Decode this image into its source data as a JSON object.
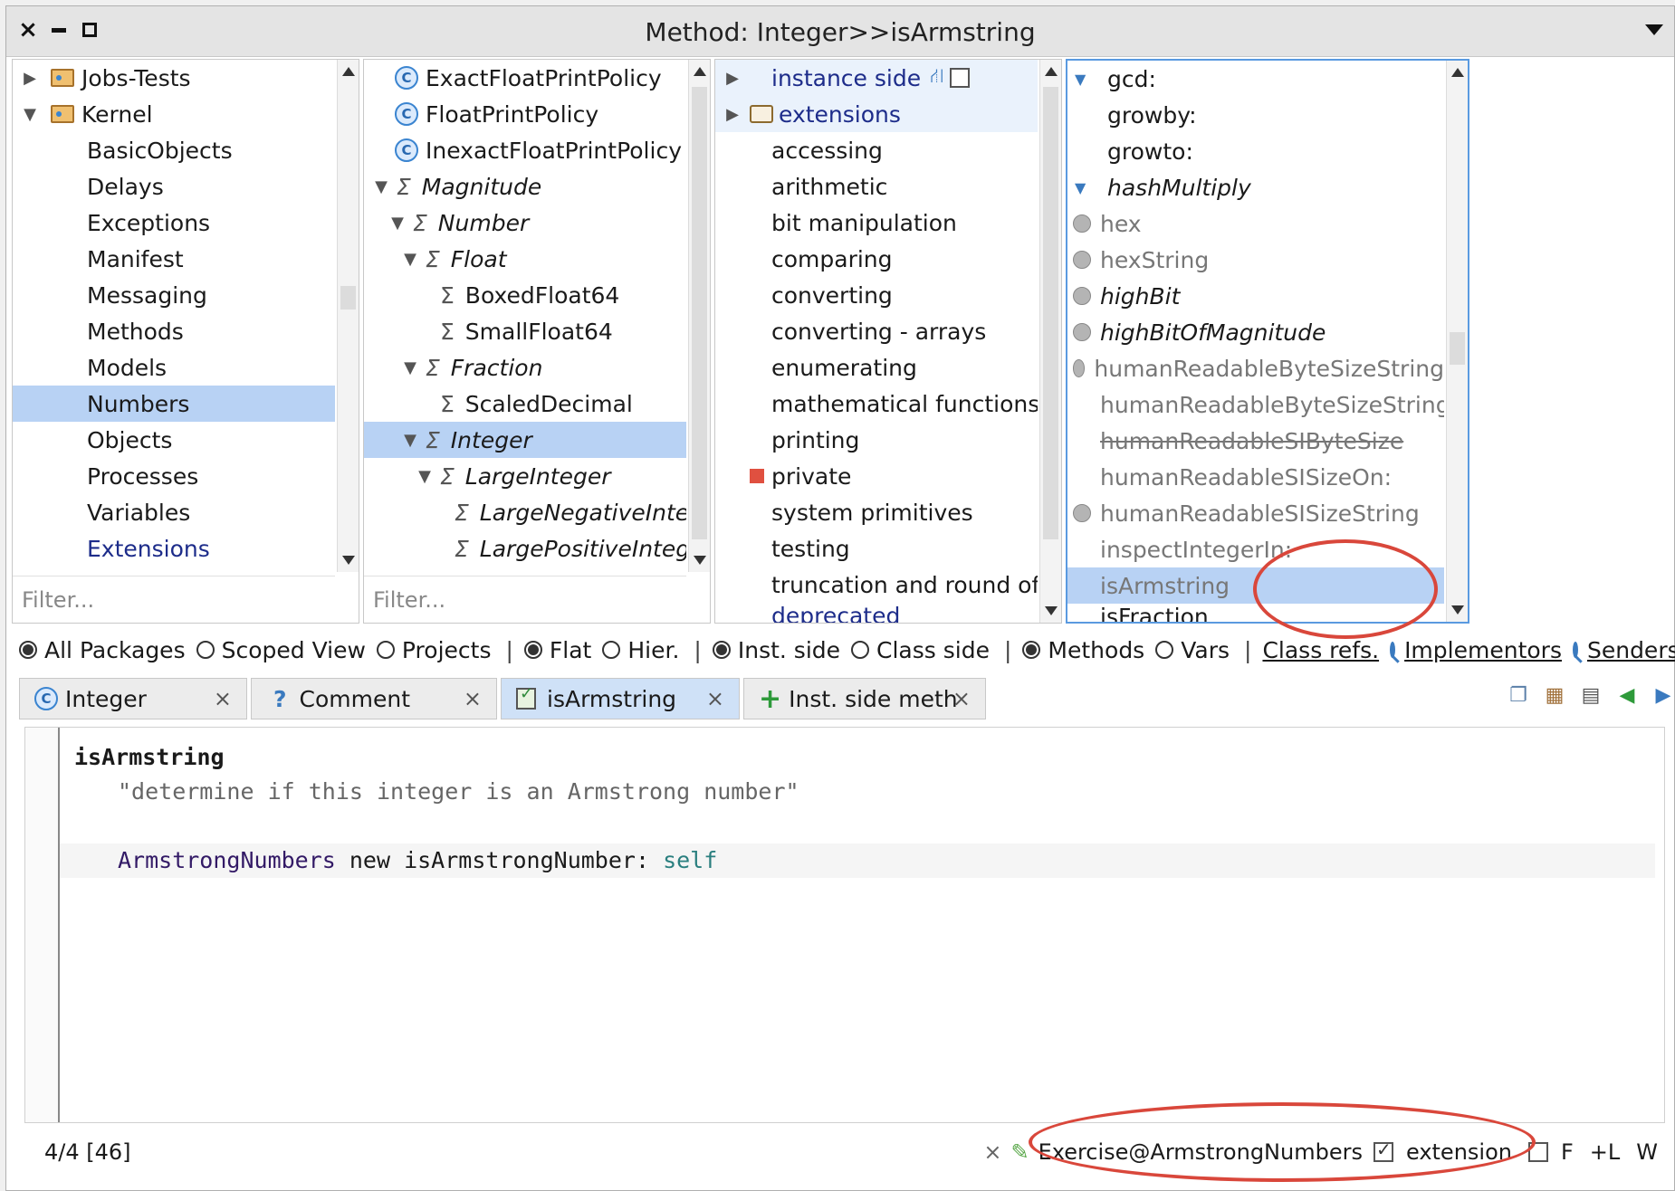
{
  "window": {
    "title": "Method: Integer>>isArmstring"
  },
  "packages": {
    "items": [
      {
        "label": "Jobs-Tests",
        "type": "package",
        "expanded": false
      },
      {
        "label": "Kernel",
        "type": "package",
        "expanded": true
      },
      {
        "label": "BasicObjects"
      },
      {
        "label": "Delays"
      },
      {
        "label": "Exceptions"
      },
      {
        "label": "Manifest"
      },
      {
        "label": "Messaging"
      },
      {
        "label": "Methods"
      },
      {
        "label": "Models"
      },
      {
        "label": "Numbers",
        "selected": true
      },
      {
        "label": "Objects"
      },
      {
        "label": "Processes"
      },
      {
        "label": "Variables"
      },
      {
        "label": "Extensions",
        "color": "blue"
      }
    ],
    "filter_placeholder": "Filter..."
  },
  "classes": {
    "items": [
      {
        "label": "ExactFloatPrintPolicy",
        "icon": "class-icon"
      },
      {
        "label": "FloatPrintPolicy",
        "icon": "class-icon"
      },
      {
        "label": "InexactFloatPrintPolicy",
        "icon": "class-icon"
      },
      {
        "label": "Magnitude",
        "icon": "sigma-icon",
        "italic": true,
        "depth": 0,
        "expanded": true
      },
      {
        "label": "Number",
        "icon": "sigma-icon",
        "italic": true,
        "depth": 1,
        "expanded": true
      },
      {
        "label": "Float",
        "icon": "sigma-icon",
        "italic": true,
        "depth": 2,
        "expanded": true
      },
      {
        "label": "BoxedFloat64",
        "icon": "sigma-icon",
        "depth": 3
      },
      {
        "label": "SmallFloat64",
        "icon": "sigma-icon",
        "depth": 3
      },
      {
        "label": "Fraction",
        "icon": "sigma-icon",
        "italic": true,
        "depth": 2,
        "expanded": true
      },
      {
        "label": "ScaledDecimal",
        "icon": "sigma-icon",
        "depth": 3
      },
      {
        "label": "Integer",
        "icon": "sigma-icon",
        "italic": true,
        "depth": 2,
        "expanded": true,
        "selected": true
      },
      {
        "label": "LargeInteger",
        "icon": "sigma-icon",
        "italic": true,
        "depth": 3,
        "expanded": true
      },
      {
        "label": "LargeNegativeInteger",
        "icon": "sigma-icon",
        "italic": true,
        "depth": 4
      },
      {
        "label": "LargePositiveInteger",
        "icon": "sigma-icon",
        "italic": true,
        "depth": 4
      }
    ],
    "filter_placeholder": "Filter..."
  },
  "protocols": {
    "items": [
      {
        "label": "instance side",
        "color": "blue",
        "expandable": true
      },
      {
        "label": "extensions",
        "color": "blue",
        "expandable": true,
        "folder": true
      },
      {
        "label": "accessing"
      },
      {
        "label": "arithmetic"
      },
      {
        "label": "bit manipulation"
      },
      {
        "label": "comparing"
      },
      {
        "label": "converting"
      },
      {
        "label": "converting - arrays"
      },
      {
        "label": "enumerating"
      },
      {
        "label": "mathematical functions"
      },
      {
        "label": "printing"
      },
      {
        "label": "private",
        "marker": "red-square"
      },
      {
        "label": "system primitives"
      },
      {
        "label": "testing"
      },
      {
        "label": "truncation and round off"
      },
      {
        "label": "deprecated",
        "color": "blue",
        "underline": true
      }
    ]
  },
  "methods": {
    "items": [
      {
        "label": "gcd:",
        "marker": "expand-arrow"
      },
      {
        "label": "growby:"
      },
      {
        "label": "growto:"
      },
      {
        "label": "hashMultiply",
        "italic": true,
        "marker": "expand-arrow"
      },
      {
        "label": "hex",
        "marker": "grey-dot",
        "grey": true
      },
      {
        "label": "hexString",
        "marker": "grey-dot",
        "grey": true
      },
      {
        "label": "highBit",
        "marker": "grey-dot",
        "italic": true
      },
      {
        "label": "highBitOfMagnitude",
        "marker": "grey-dot",
        "italic": true
      },
      {
        "label": "humanReadableByteSizeString",
        "marker": "grey-dot",
        "grey": true
      },
      {
        "label": "humanReadableByteSizeStringPreci",
        "grey": true
      },
      {
        "label": "humanReadableSIByteSize",
        "grey": true,
        "strike": true
      },
      {
        "label": "humanReadableSISizeOn:",
        "grey": true
      },
      {
        "label": "humanReadableSISizeString",
        "marker": "grey-dot",
        "grey": true
      },
      {
        "label": "inspectIntegerIn:",
        "grey": true
      },
      {
        "label": "isArmstring",
        "selected": true,
        "grey": true
      },
      {
        "label": "isFraction"
      }
    ]
  },
  "toolbar": {
    "all_packages": "All Packages",
    "scoped_view": "Scoped View",
    "projects": "Projects",
    "flat": "Flat",
    "hier": "Hier.",
    "inst_side": "Inst. side",
    "class_side": "Class side",
    "methods": "Methods",
    "vars": "Vars",
    "class_refs": "Class refs.",
    "implementors": "Implementors",
    "senders": "Senders"
  },
  "tabs": [
    {
      "label": "Integer",
      "icon": "class-icon"
    },
    {
      "label": "Comment",
      "icon": "question-icon"
    },
    {
      "label": "isArmstring",
      "icon": "edit-icon",
      "active": true
    },
    {
      "label": "Inst. side meth",
      "icon": "plus-icon"
    }
  ],
  "editor": {
    "selector": "isArmstring",
    "comment": "\"determine if this integer is an Armstrong number\"",
    "body_class": "ArmstrongNumbers",
    "body_mid": " new isArmstrongNumber: ",
    "body_arg": "self"
  },
  "status": {
    "position": "4/4 [46]",
    "package": "Exercise@ArmstrongNumbers",
    "extension_label": "extension",
    "f_label": "F",
    "l_label": "+L",
    "w_label": "W"
  },
  "colors": {
    "selection": "#b8d2f4",
    "highlight_ellipse": "#d9473b",
    "protocol_blue": "#1d2c8a"
  }
}
